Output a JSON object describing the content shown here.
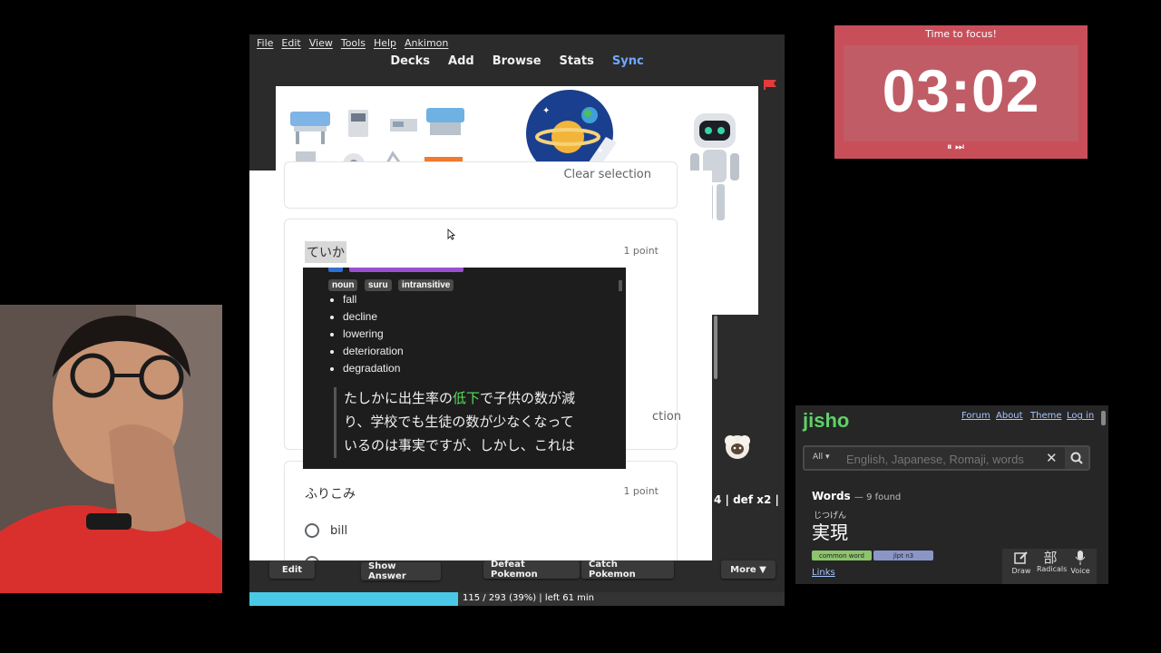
{
  "anki": {
    "menu": [
      "File",
      "Edit",
      "View",
      "Tools",
      "Help",
      "Ankimon"
    ],
    "toolbar": {
      "decks": "Decks",
      "add": "Add",
      "browse": "Browse",
      "stats": "Stats",
      "sync": "Sync"
    },
    "form": {
      "clear_selection": "Clear selection",
      "clear_selection_partial": "ction",
      "q1": {
        "title": "ていか",
        "points": "1 point"
      },
      "q2": {
        "title": "ふりこみ",
        "points": "1 point",
        "option1": "bill"
      }
    },
    "popup": {
      "tags": [
        "noun",
        "suru",
        "intransitive"
      ],
      "definitions": [
        "fall",
        "decline",
        "lowering",
        "deterioration",
        "degradation"
      ],
      "sentence": {
        "line1": "たしかに出生率の低下で子供の数が減",
        "line2": "り、学校でも生徒の数が少なくなって",
        "line3": "いるのは事実ですが、しかし、これは",
        "highlight": "低下"
      }
    },
    "buttons": {
      "edit": "Edit",
      "show_answer": "Show Answer",
      "defeat": "Defeat Pokemon",
      "catch": "Catch Pokemon",
      "more": "More ▼"
    },
    "progress": {
      "text": "115 / 293 (39%) | left 61 min",
      "fraction": 0.39
    }
  },
  "timer": {
    "title": "Time to focus!",
    "time": "03:02",
    "controls": "⏸ ⏭"
  },
  "overlay_text": "4 | def x2 |",
  "jisho": {
    "logo": "jisho",
    "links": [
      "Forum",
      "About",
      "Theme",
      "Log in"
    ],
    "search": {
      "scope": "All ▾",
      "placeholder": "English, Japanese, Romaji, words"
    },
    "words_label": "Words",
    "words_count": "— 9 found",
    "entry": {
      "furigana": "じつげん",
      "word": "実現",
      "tags": [
        "common word",
        "jlpt n3"
      ]
    },
    "links_label": "Links",
    "tools": [
      "Draw",
      "Radicals",
      "Voice"
    ]
  },
  "colors": {
    "accent": "#6fa8ff",
    "timer_bg": "#c84f5a",
    "progress": "#49c9e6",
    "jisho_green": "#5fd268",
    "highlight": "#56e05b"
  }
}
